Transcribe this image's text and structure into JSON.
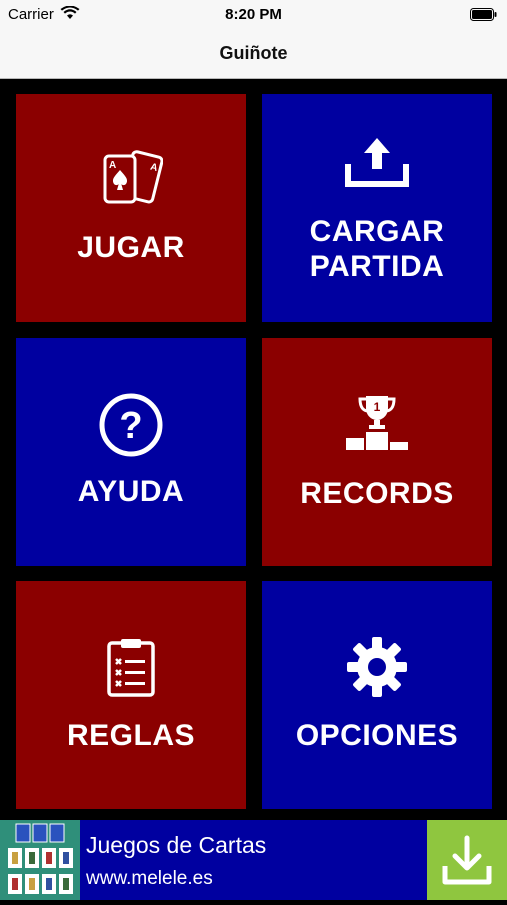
{
  "status": {
    "carrier": "Carrier",
    "time": "8:20 PM"
  },
  "nav": {
    "title": "Guiñote"
  },
  "tiles": {
    "jugar": {
      "label": "JUGAR",
      "icon": "playing-cards-icon",
      "color": "#8b0000"
    },
    "cargar": {
      "label_line1": "CARGAR",
      "label_line2": "PARTIDA",
      "icon": "upload-icon",
      "color": "#0000a0"
    },
    "ayuda": {
      "label": "AYUDA",
      "icon": "help-circle-icon",
      "color": "#0000a0"
    },
    "records": {
      "label": "RECORDS",
      "icon": "trophy-podium-icon",
      "color": "#8b0000"
    },
    "reglas": {
      "label": "REGLAS",
      "icon": "clipboard-checklist-icon",
      "color": "#8b0000"
    },
    "opciones": {
      "label": "OPCIONES",
      "icon": "gear-icon",
      "color": "#0000a0"
    }
  },
  "ad": {
    "title": "Juegos de Cartas",
    "url": "www.melele.es",
    "icon": "download-icon",
    "accent": "#8fc63f"
  }
}
